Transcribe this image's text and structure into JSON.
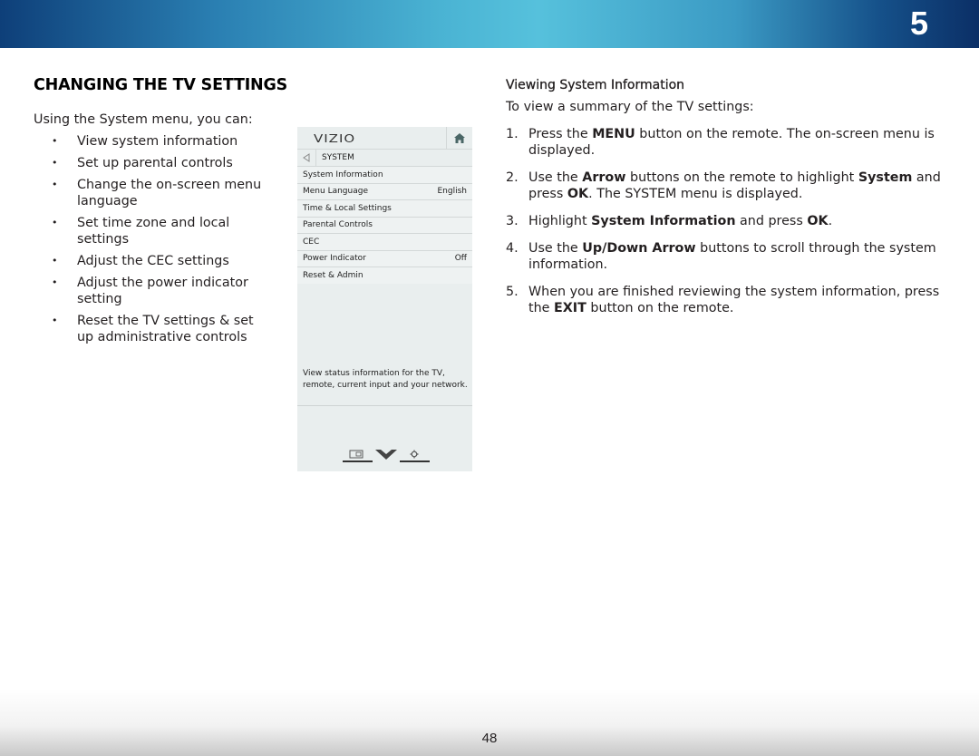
{
  "header": {
    "chapter_number": "5"
  },
  "left": {
    "title": "CHANGING THE TV SETTINGS",
    "intro": "Using the System menu, you can:",
    "bullets": [
      "View system information",
      "Set up parental controls",
      "Change the on-screen menu language",
      "Set time zone and local settings",
      "Adjust the CEC settings",
      "Adjust the power indicator setting",
      "Reset the TV settings & set up administrative controls"
    ]
  },
  "tv_menu": {
    "logo": "VIZIO",
    "icons": {
      "home": "home-icon",
      "back": "back-arrow-icon",
      "wide": "wide-icon",
      "vizio_v": "v-icon",
      "settings": "gear-icon"
    },
    "breadcrumb": "SYSTEM",
    "items": [
      {
        "label": "System Information",
        "value": ""
      },
      {
        "label": "Menu Language",
        "value": "English"
      },
      {
        "label": "Time & Local Settings",
        "value": ""
      },
      {
        "label": "Parental Controls",
        "value": ""
      },
      {
        "label": "CEC",
        "value": ""
      },
      {
        "label": "Power Indicator",
        "value": "Off"
      },
      {
        "label": "Reset & Admin",
        "value": ""
      }
    ],
    "description": "View status information for the TV, remote, current input and your network."
  },
  "right": {
    "subtitle": "Viewing System Information",
    "lead": "To view a summary of the TV settings:",
    "steps": [
      {
        "num": "1.",
        "parts": [
          "Press the ",
          "MENU",
          " button on the remote. The on-screen menu is displayed."
        ]
      },
      {
        "num": "2.",
        "parts": [
          "Use the ",
          "Arrow",
          " buttons on the remote to highlight ",
          "System",
          " and press ",
          "OK",
          ". The SYSTEM menu is displayed."
        ]
      },
      {
        "num": "3.",
        "parts": [
          "Highlight ",
          "System Information",
          " and press ",
          "OK",
          "."
        ]
      },
      {
        "num": "4.",
        "parts": [
          "Use the ",
          "Up/Down Arrow",
          " buttons to scroll through the system information."
        ]
      },
      {
        "num": "5.",
        "parts": [
          "When you are finished reviewing the system information, press the ",
          "EXIT",
          " button on the remote."
        ]
      }
    ]
  },
  "footer": {
    "page_number": "48"
  }
}
